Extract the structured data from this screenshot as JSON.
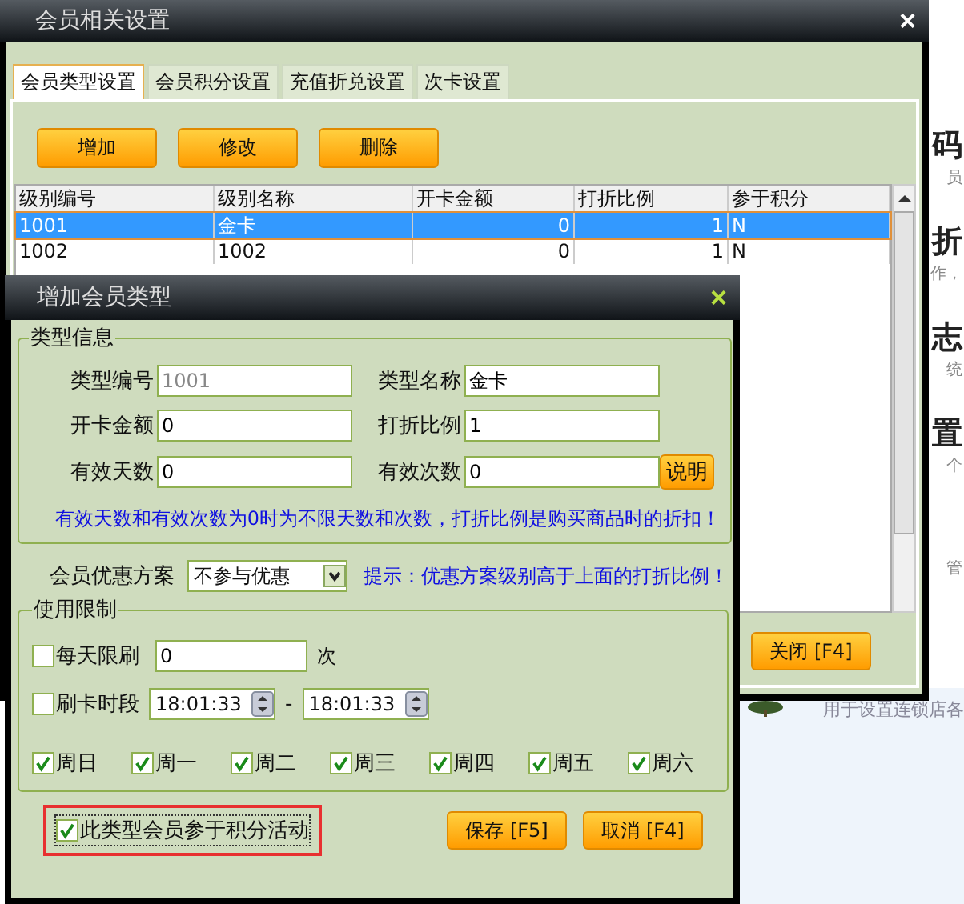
{
  "background_page": {
    "fragments": [
      {
        "kind": "heading",
        "text": "码"
      },
      {
        "kind": "note",
        "text": "员"
      },
      {
        "kind": "heading",
        "text": "折"
      },
      {
        "kind": "note",
        "text": "作，"
      },
      {
        "kind": "heading",
        "text": "志"
      },
      {
        "kind": "note",
        "text": "统"
      },
      {
        "kind": "heading",
        "text": "置"
      },
      {
        "kind": "note",
        "text": "个"
      }
    ],
    "side_note": "管",
    "footer_note": "用于设置连锁店各"
  },
  "main_window": {
    "title": "会员相关设置",
    "close": "×",
    "tabs": [
      {
        "label": "会员类型设置",
        "selected": true
      },
      {
        "label": "会员积分设置",
        "selected": false
      },
      {
        "label": "充值折兑设置",
        "selected": false
      },
      {
        "label": "次卡设置",
        "selected": false
      }
    ],
    "buttons": [
      "增加",
      "修改",
      "删除"
    ],
    "table": {
      "columns": [
        "级别编号",
        "级别名称",
        "开卡金额",
        "打折比例",
        "参于积分"
      ],
      "rows": [
        {
          "cells": [
            "1001",
            "金卡",
            "0",
            "1",
            "N"
          ],
          "selected": true
        },
        {
          "cells": [
            "1002",
            "1002",
            "0",
            "1",
            "N"
          ],
          "selected": false
        }
      ]
    },
    "close_button": "关闭 [F4]"
  },
  "dialog": {
    "title": "增加会员类型",
    "close": "×",
    "type_info": {
      "legend": "类型信息",
      "fields": [
        {
          "label": "类型编号",
          "value": "1001",
          "disabled": true
        },
        {
          "label": "类型名称",
          "value": "金卡",
          "disabled": false
        },
        {
          "label": "开卡金额",
          "value": "0",
          "disabled": false
        },
        {
          "label": "打折比例",
          "value": "1",
          "disabled": false
        },
        {
          "label": "有效天数",
          "value": "0",
          "disabled": false
        },
        {
          "label": "有效次数",
          "value": "0",
          "disabled": false
        }
      ],
      "explain_button": "说明",
      "note": "有效天数和有效次数为0时为不限天数和次数，打折比例是购买商品时的折扣！"
    },
    "discount": {
      "label": "会员优惠方案",
      "value": "不参与优惠",
      "hint": "提示：优惠方案级别高于上面的打折比例！"
    },
    "limits": {
      "legend": "使用限制",
      "daily": {
        "label": "每天限刷",
        "checked": false,
        "value": "0",
        "unit": "次"
      },
      "period": {
        "label": "刷卡时段",
        "checked": false,
        "start": "18:01:33",
        "separator": "-",
        "end": "18:01:33"
      },
      "days": [
        {
          "label": "周日",
          "checked": true
        },
        {
          "label": "周一",
          "checked": true
        },
        {
          "label": "周二",
          "checked": true
        },
        {
          "label": "周三",
          "checked": true
        },
        {
          "label": "周四",
          "checked": true
        },
        {
          "label": "周五",
          "checked": true
        },
        {
          "label": "周六",
          "checked": true
        }
      ]
    },
    "points": {
      "label": "此类型会员参于积分活动",
      "checked": true,
      "highlighted": true
    },
    "buttons": [
      "保存 [F5]",
      "取消 [F4]"
    ]
  }
}
